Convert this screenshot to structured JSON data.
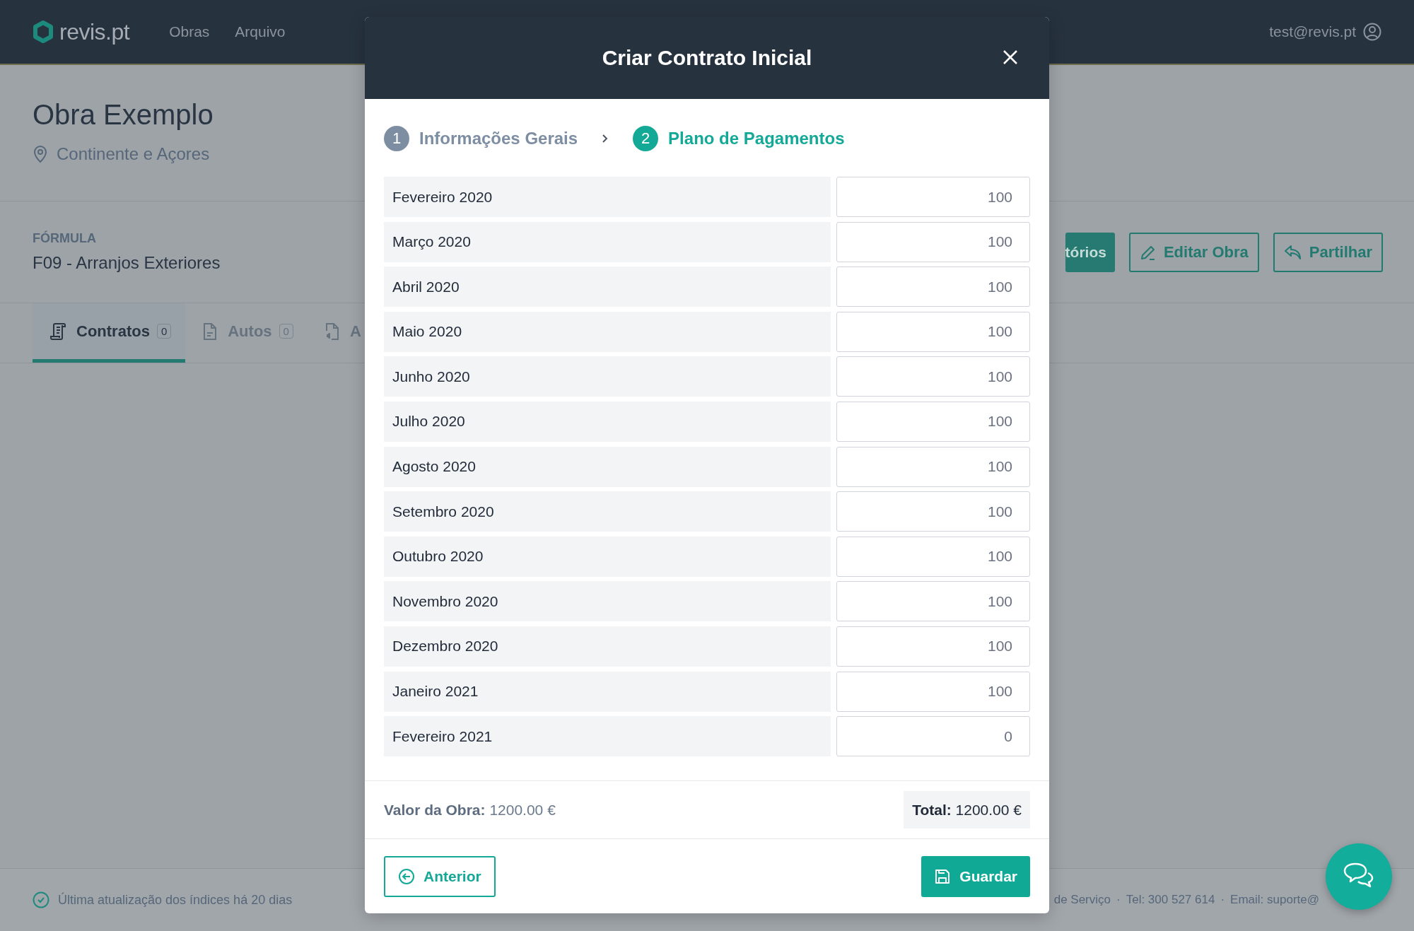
{
  "header": {
    "logo": "revis.pt",
    "nav": [
      {
        "label": "Obras"
      },
      {
        "label": "Arquivo"
      }
    ],
    "user": "test@revis.pt"
  },
  "obra": {
    "title": "Obra Exemplo",
    "location": "Continente e Açores",
    "formula_label": "FÓRMULA",
    "formula": "F09 - Arranjos Exteriores"
  },
  "actions": [
    {
      "label": "tórios",
      "kind": "filled"
    },
    {
      "label": "Editar Obra",
      "kind": "edit"
    },
    {
      "label": "Partilhar",
      "kind": "share"
    }
  ],
  "tabs": [
    {
      "label": "Contratos",
      "count": "0",
      "kind": "contract",
      "selected": true
    },
    {
      "label": "Autos",
      "count": "0",
      "kind": "document",
      "selected": false
    },
    {
      "label": "A",
      "kind": "euro",
      "selected": false
    }
  ],
  "footer": {
    "status": "Última atualização dos índices há 20 dias",
    "links": [
      "de Serviço",
      "·",
      "Tel: 300 527 614",
      "·",
      "Email: suporte@"
    ]
  },
  "modal": {
    "title": "Criar Contrato Inicial",
    "steps": [
      {
        "number": "1",
        "label": "Informações Gerais",
        "selected": false
      },
      {
        "number": "2",
        "label": "Plano de Pagamentos",
        "selected": true
      }
    ],
    "rows": [
      {
        "month": "Fevereiro 2020",
        "value": "100"
      },
      {
        "month": "Março 2020",
        "value": "100"
      },
      {
        "month": "Abril 2020",
        "value": "100"
      },
      {
        "month": "Maio 2020",
        "value": "100"
      },
      {
        "month": "Junho 2020",
        "value": "100"
      },
      {
        "month": "Julho 2020",
        "value": "100"
      },
      {
        "month": "Agosto 2020",
        "value": "100"
      },
      {
        "month": "Setembro 2020",
        "value": "100"
      },
      {
        "month": "Outubro 2020",
        "value": "100"
      },
      {
        "month": "Novembro 2020",
        "value": "100"
      },
      {
        "month": "Dezembro 2020",
        "value": "100"
      },
      {
        "month": "Janeiro 2021",
        "value": "100"
      },
      {
        "month": "Fevereiro 2021",
        "value": "0"
      }
    ],
    "valor": "**Valor da Obra:** 1200.00 €",
    "total": "**Total:** 1200.00 €",
    "buttons": [
      {
        "label": "Anterior",
        "kind": "back"
      },
      {
        "label": "Guardar",
        "kind": "save"
      }
    ]
  }
}
